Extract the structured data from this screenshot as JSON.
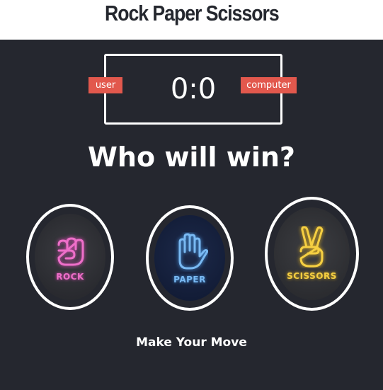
{
  "header": {
    "title": "Rock Paper Scissors"
  },
  "scoreboard": {
    "score": "0:0",
    "user_label": "user",
    "computer_label": "computer"
  },
  "prompt": {
    "question": "Who will win?"
  },
  "choices": [
    {
      "label": "ROCK",
      "icon": "rock-fist-icon",
      "color": "#ee6fc9"
    },
    {
      "label": "PAPER",
      "icon": "paper-hand-icon",
      "color": "#79b9f2"
    },
    {
      "label": "SCISSORS",
      "icon": "scissors-peace-hand-icon",
      "color": "#f5cf42"
    }
  ],
  "footer": {
    "instruction": "Make Your Move"
  },
  "colors": {
    "background": "#25272f",
    "badge": "#e2584d",
    "header_background": "#ffffff"
  }
}
